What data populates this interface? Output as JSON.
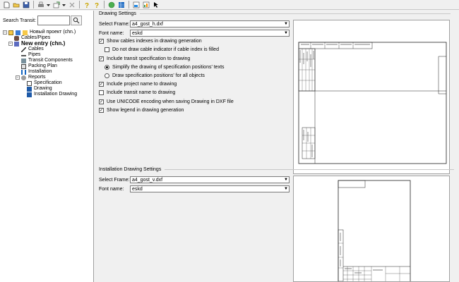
{
  "toolbar": {
    "icons": [
      "new-file-icon",
      "open-folder-icon",
      "save-icon",
      "print-icon",
      "arrow-down-icon",
      "export-icon",
      "arrow-down-icon",
      "delete-icon",
      "hint-icon",
      "help-icon",
      "globe-icon",
      "table-icon",
      "image-icon",
      "chart-icon",
      "cursor-icon"
    ]
  },
  "search": {
    "label": "Search Transit:",
    "value": ""
  },
  "tree": {
    "root": "Новый проект (chn.)",
    "cables_pipes": "Cables/Pipes",
    "new_entry": "New entry (chn.)",
    "cables": "Cables",
    "pipes": "Pipes",
    "transit_components": "Transit Components",
    "packing_plan": "Packing Plan",
    "installation": "Installation",
    "reports": "Reports",
    "specification": "Specification",
    "drawing": "Drawing",
    "installation_drawing": "Installation Drawing"
  },
  "drawing_settings": {
    "title": "Drawing Settings",
    "select_frame_label": "Select Frame:",
    "select_frame_value": "a4_gost_h.dxf",
    "font_name_label": "Font name:",
    "font_name_value": "eskd",
    "options": {
      "show_cable_indexes": "Show cables indexes in drawing generation",
      "no_cable_indicator": "Do not draw cable indicator if cable index is filled",
      "include_transit_spec": "Include transit specification to drawing",
      "simplify_positions": "Simplify the drawing of specification positions' texts",
      "draw_spec_positions": "Draw specification positions' for all objects",
      "include_project_name": "Include project name to drawing",
      "include_transit_name": "Include transit name to drawing",
      "use_unicode": "Use UNICODE encoding when saving Drawing in DXF file",
      "show_legend": "Show legend in drawing generation"
    }
  },
  "installation_settings": {
    "title": "Installation Drawing Settings",
    "select_frame_label": "Select Frame:",
    "select_frame_value": "a4_gost_v.dxf",
    "font_name_label": "Font name:",
    "font_name_value": "eskd"
  }
}
